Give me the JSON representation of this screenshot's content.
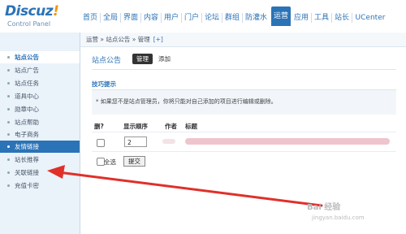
{
  "logo": {
    "main": "Discuz",
    "excl": "!",
    "sub": "Control Panel"
  },
  "nav": {
    "items": [
      "首页",
      "全局",
      "界面",
      "内容",
      "用户",
      "门户",
      "论坛",
      "群组",
      "防灌水",
      "运营",
      "应用",
      "工具",
      "站长",
      "UCenter"
    ],
    "active_index": 9
  },
  "sidebar": {
    "items": [
      "站点公告",
      "站点广告",
      "站点任务",
      "道具中心",
      "勋章中心",
      "站点帮助",
      "电子商务",
      "友情链接",
      "站长推荐",
      "关联链接",
      "充值卡密"
    ],
    "active_index": 0,
    "highlight_index": 7
  },
  "breadcrumb": {
    "text": "运营 » 站点公告 » 管理",
    "plus": "[+]"
  },
  "main": {
    "title": "站点公告",
    "tab_manage": "管理",
    "tab_add": "添加",
    "tips_title": "技巧提示",
    "tips_text": "* 如果您不是站点管理员，你将只能对自己添加的项目进行编辑或删除。",
    "columns": {
      "delete": "删?",
      "order": "显示顺序",
      "author": "作者",
      "title": "标题"
    },
    "row": {
      "order_value": "2"
    },
    "select_all": "全选",
    "submit": "提交"
  },
  "watermark": {
    "main": "Bai 经验",
    "sub": "jingyan.baidu.com"
  },
  "colors": {
    "accent": "#2b73b7",
    "arrow": "#e0302a"
  }
}
